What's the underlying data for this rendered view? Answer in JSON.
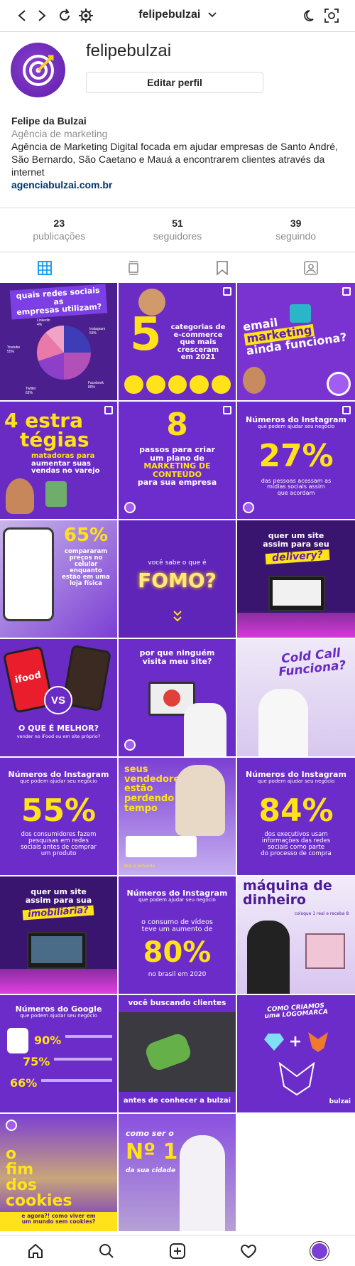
{
  "topbar": {
    "username": "felipebulzai"
  },
  "profile": {
    "username": "felipebulzai",
    "edit_label": "Editar perfil",
    "name": "Felipe da Bulzai",
    "category": "Agência de marketing",
    "description": "Agência de Marketing Digital focada em ajudar empresas de Santo André, São Bernardo, São Caetano e Mauá a encontrarem clientes através da internet",
    "link": "agenciabulzai.com.br"
  },
  "stats": [
    {
      "num": "23",
      "label": "publicações"
    },
    {
      "num": "51",
      "label": "seguidores"
    },
    {
      "num": "39",
      "label": "seguindo"
    }
  ],
  "tabs": [
    "grid-icon",
    "igtv-icon",
    "saved-icon",
    "tagged-icon"
  ],
  "posts": [
    {
      "lines": [
        "quais redes sociais as",
        "empresas utilizam?"
      ],
      "labels": [
        "Linkedin 4%",
        "Instagram 53%",
        "Youtube 55%",
        "Twitter 62%",
        "Facebook 80%"
      ]
    },
    {
      "lines": [
        "5",
        "categorias de",
        "e-commerce",
        "que mais",
        "cresceram",
        "em 2021"
      ]
    },
    {
      "lines": [
        "email",
        "marketing",
        "ainda funciona?"
      ]
    },
    {
      "lines": [
        "4 estra",
        "tégias",
        "matadoras para",
        "aumentar suas",
        "vendas no varejo"
      ]
    },
    {
      "lines": [
        "8",
        "passos para criar",
        "um plano de",
        "MARKETING DE",
        "CONTEÚDO",
        "para sua empresa"
      ]
    },
    {
      "lines": [
        "Números do Instagram",
        "que podem ajudar seu negócio",
        "27%",
        "das pessoas acessam as",
        "mídias sociais assim",
        "que acordam"
      ]
    },
    {
      "lines": [
        "65%",
        "compararam",
        "preços no",
        "celular",
        "enquanto",
        "estão em uma",
        "loja física"
      ]
    },
    {
      "lines": [
        "você sabe o que é",
        "FOMO?"
      ]
    },
    {
      "lines": [
        "quer um site",
        "assim para seu",
        "delivery?"
      ]
    },
    {
      "lines": [
        "VS",
        "O QUE É MELHOR?",
        "vender no iFood ou em site próprio?",
        "ifood"
      ]
    },
    {
      "lines": [
        "por que ninguém",
        "visita meu site?"
      ]
    },
    {
      "lines": [
        "Cold Call",
        "Funciona?"
      ]
    },
    {
      "lines": [
        "Números do Instagram",
        "que podem ajudar seu negócio",
        "55%",
        "dos consumidores fazem",
        "pesquisas em redes",
        "sociais antes de comprar",
        "um produto"
      ]
    },
    {
      "lines": [
        "seus",
        "vendedores",
        "estão",
        "perdendo",
        "tempo",
        "leia e entenda"
      ]
    },
    {
      "lines": [
        "Números do Instagram",
        "que podem ajudar seu negócio",
        "84%",
        "dos executivos usam",
        "informações das redes",
        "sociais como parte",
        "do processo de compra"
      ]
    },
    {
      "lines": [
        "quer um site",
        "assim para sua",
        "imobiliária?"
      ]
    },
    {
      "lines": [
        "Números do Instagram",
        "que podem ajudar seu negócio",
        "o consumo de vídeos",
        "teve um aumento de",
        "80%",
        "no brasil em 2020"
      ]
    },
    {
      "lines": [
        "máquina de",
        "dinheiro",
        "coloque 1 real e receba 8"
      ]
    },
    {
      "lines": [
        "Números do Google",
        "que podem ajudar seu negócio",
        "90%",
        "75%",
        "66%"
      ]
    },
    {
      "lines": [
        "você buscando clientes",
        "antes de conhecer a bulzai"
      ]
    },
    {
      "lines": [
        "COMO CRIAMOS",
        "uma LOGOMARCA",
        "+",
        "bulzai"
      ]
    },
    {
      "lines": [
        "o",
        "fim",
        "dos",
        "cookies",
        "e agora?! como viver em",
        "um mundo sem cookies?"
      ]
    },
    {
      "lines": [
        "como ser o",
        "Nº 1",
        "da sua cidade"
      ]
    }
  ],
  "bottomnav": [
    "home-icon",
    "search-icon",
    "new-post-icon",
    "activity-icon",
    "profile-avatar"
  ]
}
